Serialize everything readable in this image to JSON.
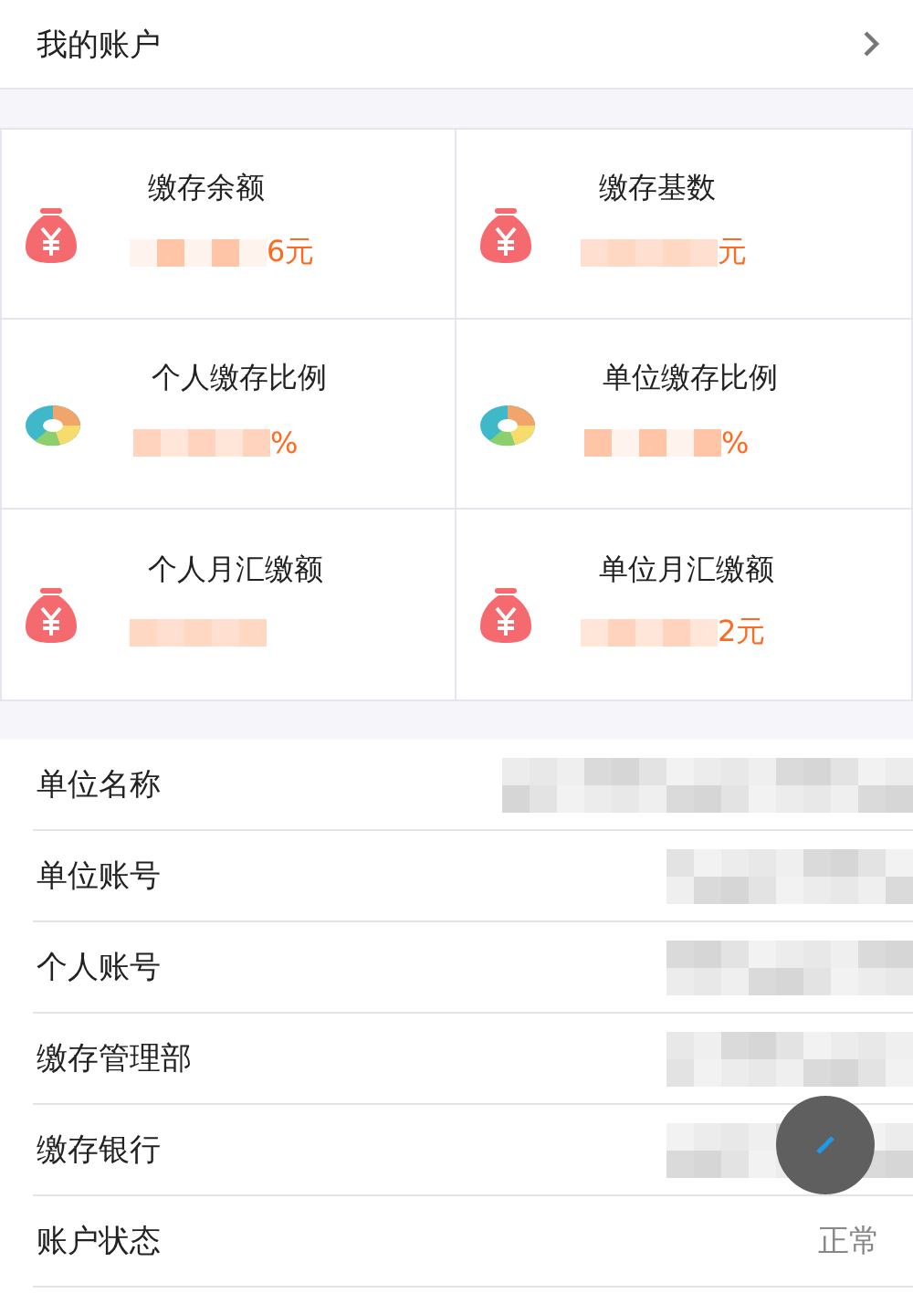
{
  "header": {
    "title": "我的账户"
  },
  "tiles": [
    {
      "kind": "bag",
      "label": "缴存余额",
      "value": "6元",
      "redacted": true
    },
    {
      "kind": "bag",
      "label": "缴存基数",
      "value": "元",
      "redacted": true
    },
    {
      "kind": "ring",
      "label": "个人缴存比例",
      "value": "%",
      "redacted": true
    },
    {
      "kind": "ring",
      "label": "单位缴存比例",
      "value": "%",
      "redacted": true
    },
    {
      "kind": "bag",
      "label": "个人月汇缴额",
      "redacted": true
    },
    {
      "kind": "bag",
      "label": "单位月汇缴额",
      "value": "2元",
      "redacted": true
    }
  ],
  "rows": [
    {
      "label": "单位名称",
      "redacted": true
    },
    {
      "label": "单位账号",
      "redacted": true
    },
    {
      "label": "个人账号",
      "redacted": true
    },
    {
      "label": "缴存管理部",
      "redacted": true
    },
    {
      "label": "缴存银行",
      "redacted": true
    },
    {
      "label": "账户状态",
      "value": "正常",
      "redacted": false
    }
  ]
}
